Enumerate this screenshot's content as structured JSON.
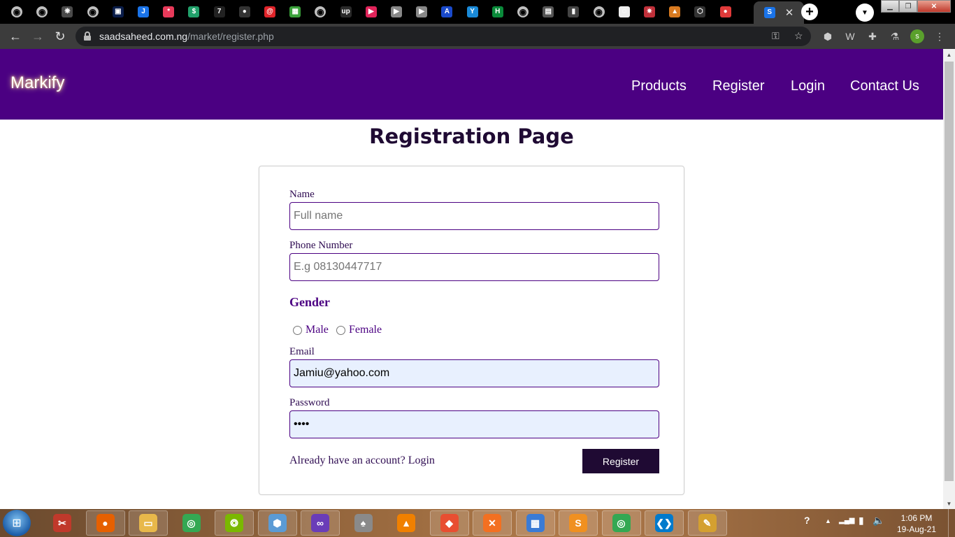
{
  "browser": {
    "tabs": [
      {
        "icon": "globe-icon",
        "glyph": "◉"
      },
      {
        "icon": "globe-icon",
        "glyph": "◉"
      },
      {
        "icon": "openai-icon",
        "glyph": "❋"
      },
      {
        "icon": "globe-icon",
        "glyph": "◉"
      },
      {
        "icon": "tab-app-icon",
        "glyph": "▣"
      },
      {
        "icon": "tab-app-icon",
        "glyph": "J"
      },
      {
        "icon": "asterisk-icon",
        "glyph": "*"
      },
      {
        "icon": "tab-app-icon",
        "glyph": "$"
      },
      {
        "icon": "tab-app-icon",
        "glyph": "7"
      },
      {
        "icon": "github-icon",
        "glyph": "●"
      },
      {
        "icon": "tab-app-icon",
        "glyph": "@"
      },
      {
        "icon": "tab-app-icon",
        "glyph": "▦"
      },
      {
        "icon": "globe-icon",
        "glyph": "◉"
      },
      {
        "icon": "upwork-icon",
        "glyph": "up"
      },
      {
        "icon": "play-icon",
        "glyph": "▶"
      },
      {
        "icon": "play-icon",
        "glyph": "▶"
      },
      {
        "icon": "play-icon",
        "glyph": "▶"
      },
      {
        "icon": "tab-app-icon",
        "glyph": "A"
      },
      {
        "icon": "tab-app-icon",
        "glyph": "Y"
      },
      {
        "icon": "tab-app-icon",
        "glyph": "H"
      },
      {
        "icon": "globe-icon",
        "glyph": "◉"
      },
      {
        "icon": "tab-app-icon",
        "glyph": "▤"
      },
      {
        "icon": "bar-chart-icon",
        "glyph": "▮"
      },
      {
        "icon": "globe-icon",
        "glyph": "◉"
      },
      {
        "icon": "avatar-icon",
        "glyph": "☺"
      },
      {
        "icon": "tab-app-icon",
        "glyph": "✷"
      },
      {
        "icon": "tab-app-icon",
        "glyph": "▲"
      },
      {
        "icon": "laravel-icon",
        "glyph": "⬡"
      },
      {
        "icon": "tab-app-icon",
        "glyph": "●"
      }
    ],
    "active_tab_glyph": "S",
    "tab_close": "✕",
    "new_tab": "+",
    "tab_search": "▼",
    "window_controls": {
      "minimize": "▁",
      "maximize": "❐",
      "close": "✕"
    },
    "nav": {
      "back": "←",
      "forward": "→",
      "reload": "↻"
    },
    "url_domain": "saadsaheed.com.ng",
    "url_path": "/market/register.php",
    "omnibox_icons": {
      "key": "⚿",
      "star": "☆"
    },
    "extensions": [
      "⬢",
      "W",
      "✚",
      "⚗"
    ],
    "profile_initial": "s"
  },
  "site": {
    "brand": "Markify",
    "nav": [
      "Products",
      "Register",
      "Login",
      "Contact Us"
    ]
  },
  "form": {
    "title": "Registration Page",
    "name_label": "Name",
    "name_placeholder": "Full name",
    "phone_label": "Phone Number",
    "phone_placeholder": "E.g 08130447717",
    "gender_label": "Gender",
    "gender_options": [
      "Male",
      "Female"
    ],
    "email_label": "Email",
    "email_value": "Jamiu@yahoo.com",
    "password_label": "Password",
    "password_value": "••••",
    "login_prompt": "Already have an account? Login",
    "submit_label": "Register"
  },
  "taskbar": {
    "apps": [
      {
        "name": "snipping-tool-icon",
        "glyph": "✂",
        "color": "#c0392b"
      },
      {
        "name": "firefox-icon",
        "glyph": "●",
        "color": "#e66000"
      },
      {
        "name": "file-explorer-icon",
        "glyph": "▭",
        "color": "#e8b84a"
      },
      {
        "name": "chrome-icon",
        "glyph": "◎",
        "color": "#34a853"
      },
      {
        "name": "chameleon-icon",
        "glyph": "❂",
        "color": "#7ab800"
      },
      {
        "name": "virtualbox-icon",
        "glyph": "⬢",
        "color": "#5b9bd5"
      },
      {
        "name": "visual-studio-icon",
        "glyph": "∞",
        "color": "#6a3db8"
      },
      {
        "name": "tree-icon",
        "glyph": "♠",
        "color": "#8a8a8a"
      },
      {
        "name": "vlc-icon",
        "glyph": "▲",
        "color": "#f08000"
      },
      {
        "name": "git-icon",
        "glyph": "◆",
        "color": "#e84e31"
      },
      {
        "name": "xampp-icon",
        "glyph": "✕",
        "color": "#f37021"
      },
      {
        "name": "photos-icon",
        "glyph": "▦",
        "color": "#3a7bd5"
      },
      {
        "name": "sublime-text-icon",
        "glyph": "S",
        "color": "#f09020"
      },
      {
        "name": "chrome-profile-icon",
        "glyph": "◎",
        "color": "#34a853"
      },
      {
        "name": "vscode-icon",
        "glyph": "❮❯",
        "color": "#007acc"
      },
      {
        "name": "paint-icon",
        "glyph": "✎",
        "color": "#d4a030"
      }
    ],
    "tray": {
      "help": "?",
      "arrow": "▲",
      "signal": "▂▄▆",
      "battery": "▮",
      "volume": "🔈"
    },
    "time": "1:06 PM",
    "date": "19-Aug-21"
  },
  "colors": {
    "header": "#4b0082",
    "button": "#1f0a33",
    "title": "#1f0a33",
    "autofill": "#e8f0fe"
  }
}
